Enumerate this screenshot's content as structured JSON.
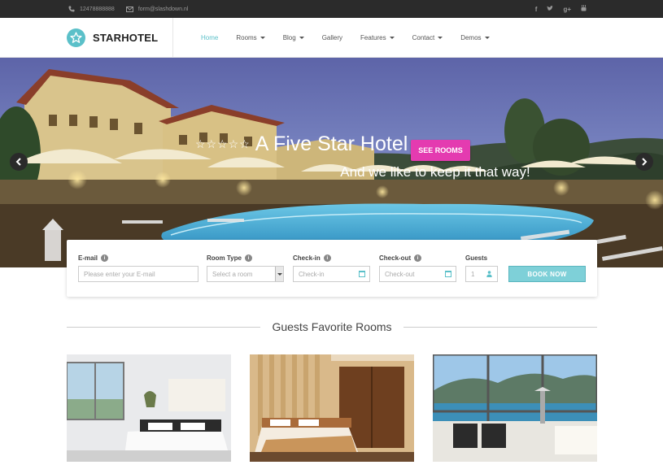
{
  "topbar": {
    "phone": "12478888888",
    "email": "form@slashdown.nl",
    "social": [
      "facebook-icon",
      "twitter-icon",
      "google-plus-icon",
      "youtube-icon"
    ]
  },
  "header": {
    "brand": "STARHOTEL",
    "nav": [
      {
        "label": "Home",
        "active": true,
        "dropdown": false
      },
      {
        "label": "Rooms",
        "active": false,
        "dropdown": true
      },
      {
        "label": "Blog",
        "active": false,
        "dropdown": true
      },
      {
        "label": "Gallery",
        "active": false,
        "dropdown": false
      },
      {
        "label": "Features",
        "active": false,
        "dropdown": true
      },
      {
        "label": "Contact",
        "active": false,
        "dropdown": true
      },
      {
        "label": "Demos",
        "active": false,
        "dropdown": true
      }
    ]
  },
  "hero": {
    "title": "A Five Star Hotel",
    "stars": "☆☆☆☆☆",
    "subtitle": "And we like to keep it that way!",
    "cta": "SEE ROOMS"
  },
  "booking": {
    "email_label": "E-mail",
    "email_placeholder": "Please enter your E-mail",
    "room_label": "Room Type",
    "room_value": "Select a room",
    "checkin_label": "Check-in",
    "checkin_placeholder": "Check-in",
    "checkout_label": "Check-out",
    "checkout_placeholder": "Check-out",
    "guests_label": "Guests",
    "guests_value": "1",
    "submit": "BOOK NOW"
  },
  "section": {
    "title": "Guests Favorite Rooms"
  },
  "colors": {
    "accent": "#5bc0c9",
    "cta": "#e43bb0",
    "topbar": "#2b2b2b"
  }
}
